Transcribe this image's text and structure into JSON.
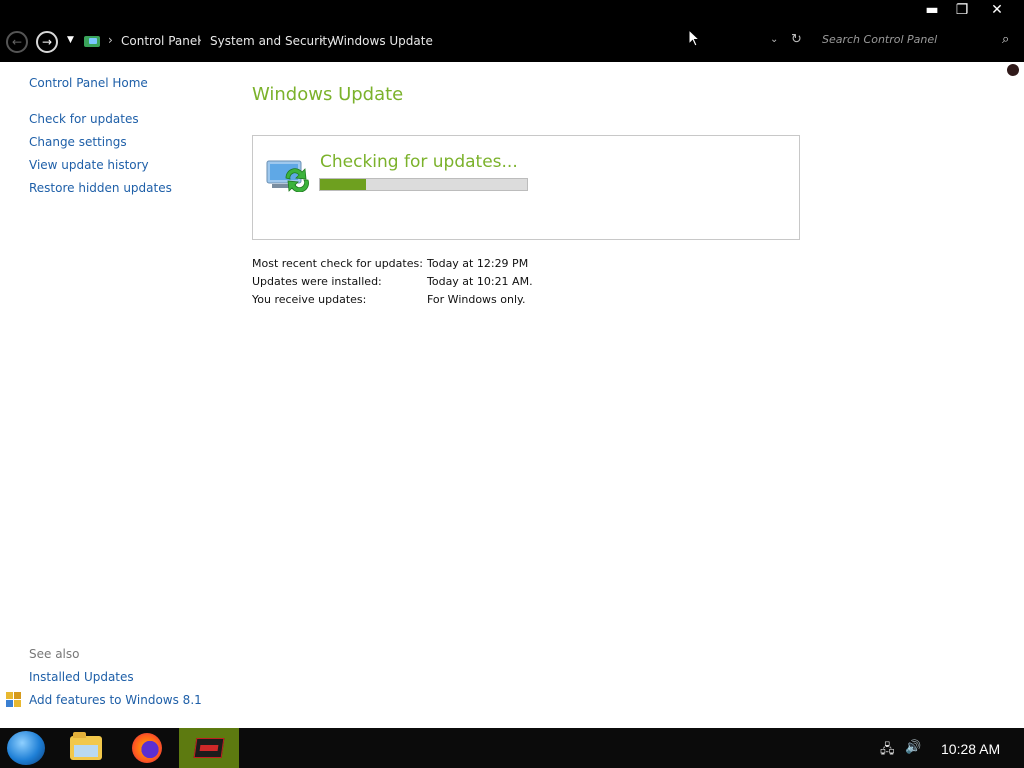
{
  "window": {
    "minimize_glyph": "▬",
    "restore_glyph": "❐",
    "close_glyph": "✕"
  },
  "address_bar": {
    "breadcrumb": [
      "Control Panel",
      "System and Security",
      "Windows Update"
    ],
    "search_placeholder": "Search Control Panel"
  },
  "sidebar": {
    "home": "Control Panel Home",
    "links": [
      "Check for updates",
      "Change settings",
      "View update history",
      "Restore hidden updates"
    ],
    "see_also_heading": "See also",
    "see_also_links": [
      "Installed Updates",
      "Add features to Windows 8.1"
    ]
  },
  "main": {
    "title": "Windows Update",
    "status_text": "Checking for updates...",
    "progress_fraction": 0.22,
    "info": [
      {
        "label": "Most recent check for updates:",
        "value": "Today at 12:29 PM"
      },
      {
        "label": "Updates were installed:",
        "value": "Today at 10:21 AM."
      },
      {
        "label": "You receive updates:",
        "value": "For Windows only."
      }
    ]
  },
  "taskbar": {
    "apps": [
      "start-orb-icon",
      "file-explorer-icon",
      "firefox-icon",
      "game-app-icon"
    ],
    "clock": "10:28 AM"
  },
  "colors": {
    "accent": "#7bb22b",
    "link": "#1e5fa8",
    "progress": "#6ea01f",
    "chrome": "#000000"
  }
}
